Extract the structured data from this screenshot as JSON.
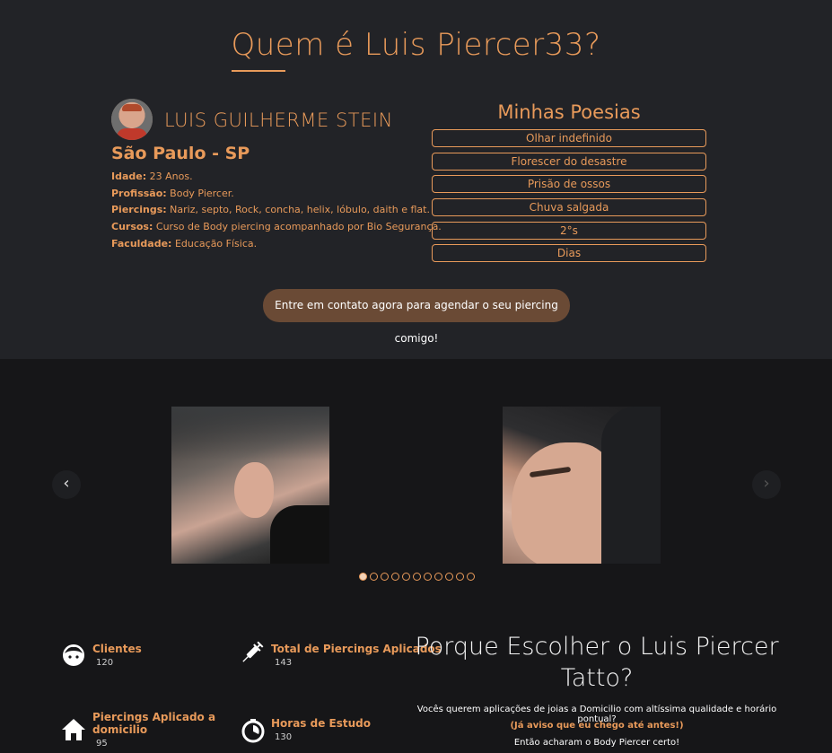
{
  "header": {
    "title": "Quem é Luis Piercer33?"
  },
  "profile": {
    "name": "LUIS GUILHERME STEIN",
    "city": "São Paulo - SP",
    "fields": [
      {
        "label": "Idade:",
        "value": " 23 Anos."
      },
      {
        "label": "Profissão:",
        "value": " Body Piercer."
      },
      {
        "label": "Piercings:",
        "value": " Nariz, septo, Rock, concha, helix, lóbulo, daith e flat."
      },
      {
        "label": "Cursos:",
        "value": " Curso de Body piercing acompanhado por Bio Segurança."
      },
      {
        "label": "Faculdade:",
        "value": " Educação Física."
      }
    ]
  },
  "poems": {
    "title": "Minhas Poesias",
    "items": [
      "Olhar indefinido",
      "Florescer do desastre",
      "Prisão de ossos",
      "Chuva salgada",
      "2°s",
      "Dias"
    ]
  },
  "cta": {
    "label": "Entre em contato agora para agendar o seu piercing comigo!"
  },
  "carousel": {
    "prev": "‹",
    "next": "›",
    "dot_count": 11,
    "active_dot": 0
  },
  "stats": [
    {
      "label": "Clientes",
      "value": "120",
      "icon": "face-icon"
    },
    {
      "label": "Total de Piercings Aplicados",
      "value": "143",
      "icon": "syringe-icon"
    },
    {
      "label": "Piercings Aplicado a domicilio",
      "value": "95",
      "icon": "home-icon"
    },
    {
      "label": "Horas de Estudo",
      "value": "130",
      "icon": "timer-icon"
    }
  ],
  "why": {
    "title": "Porque Escolher o Luis Piercer Tatto?",
    "p1": "Vocês querem aplicações de joias a Domicilio com altíssima qualidade e horário pontual?",
    "p2": "(Já aviso que eu chego até antes!)",
    "p3": "Então acharam o Body Piercer certo!"
  },
  "colors": {
    "accent": "#e89a5a",
    "top_bg": "#222327",
    "bottom_bg": "#161618",
    "cta_bg": "#6a4a35"
  }
}
